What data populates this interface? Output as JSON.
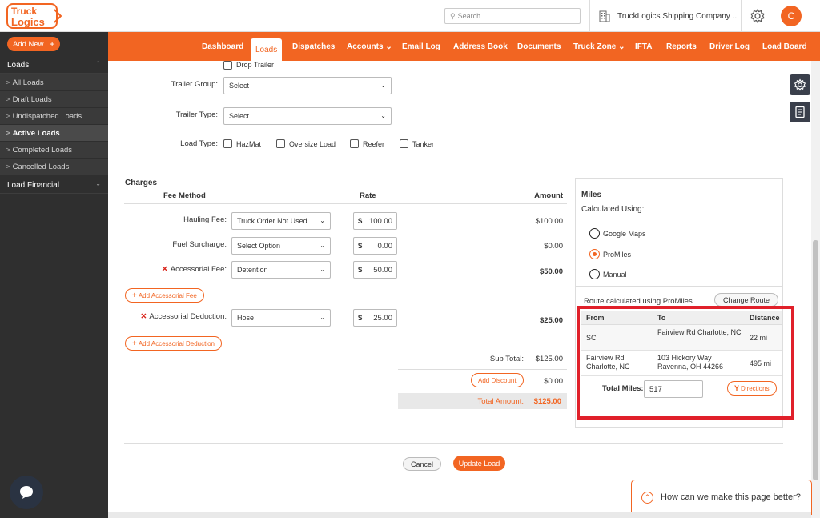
{
  "brand": {
    "logo_line1": "Truck",
    "logo_line2": "Logics",
    "accent": "#f26522"
  },
  "header": {
    "search_placeholder": "Search",
    "company": "TruckLogics Shipping Company ...",
    "avatar_initial": "C"
  },
  "sidebar": {
    "add_new": "Add New",
    "loads_header": "Loads",
    "items": [
      "All Loads",
      "Draft Loads",
      "Undispatched Loads",
      "Active Loads",
      "Completed Loads",
      "Cancelled Loads"
    ],
    "financial_header": "Load Financial"
  },
  "nav": [
    "Dashboard",
    "Loads",
    "Dispatches",
    "Accounts",
    "Email Log",
    "Address Book",
    "Documents",
    "Truck Zone",
    "IFTA",
    "Reports",
    "Driver Log",
    "Load Board"
  ],
  "trailer": {
    "drop_trailer": "Drop Trailer",
    "group_label": "Trailer Group:",
    "group_value": "Select",
    "type_label": "Trailer Type:",
    "type_value": "Select",
    "load_type_label": "Load Type:",
    "load_types": [
      "HazMat",
      "Oversize Load",
      "Reefer",
      "Tanker"
    ]
  },
  "charges": {
    "title": "Charges",
    "col_fee_method": "Fee Method",
    "col_rate": "Rate",
    "col_amount": "Amount",
    "hauling_label": "Hauling Fee:",
    "hauling_method": "Truck Order Not Used",
    "hauling_rate": "100.00",
    "hauling_amount": "$100.00",
    "fuel_label": "Fuel Surcharge:",
    "fuel_method": "Select Option",
    "fuel_rate": "0.00",
    "fuel_amount": "$0.00",
    "acc_fee_label": "Accessorial Fee:",
    "acc_fee_method": "Detention",
    "acc_fee_rate": "50.00",
    "acc_fee_amount": "$50.00",
    "add_acc_fee": "Add Accessorial Fee",
    "acc_ded_label": "Accessorial Deduction:",
    "acc_ded_method": "Hose",
    "acc_ded_rate": "25.00",
    "acc_ded_amount": "$25.00",
    "add_acc_ded": "Add Accessorial Deduction",
    "currency": "$",
    "subtotal_label": "Sub Total:",
    "subtotal": "$125.00",
    "add_discount": "Add Discount",
    "discount": "$0.00",
    "total_label": "Total Amount:",
    "total": "$125.00"
  },
  "miles": {
    "title": "Miles",
    "calc_using": "Calculated Using:",
    "options": [
      "Google Maps",
      "ProMiles",
      "Manual"
    ],
    "selected": "ProMiles",
    "route_note": "Route calculated using ProMiles",
    "change_route": "Change Route",
    "col_from": "From",
    "col_to": "To",
    "col_distance": "Distance",
    "rows": [
      {
        "from": "SC",
        "to": "Fairview Rd Charlotte, NC",
        "distance": "22 mi"
      },
      {
        "from": "Fairview Rd Charlotte, NC",
        "to": "103 Hickory Way Ravenna, OH 44266",
        "distance": "495 mi"
      }
    ],
    "total_label": "Total Miles:",
    "total": "517",
    "directions": "Directions"
  },
  "actions": {
    "cancel": "Cancel",
    "update": "Update Load"
  },
  "feedback": "How can we make this page better?"
}
